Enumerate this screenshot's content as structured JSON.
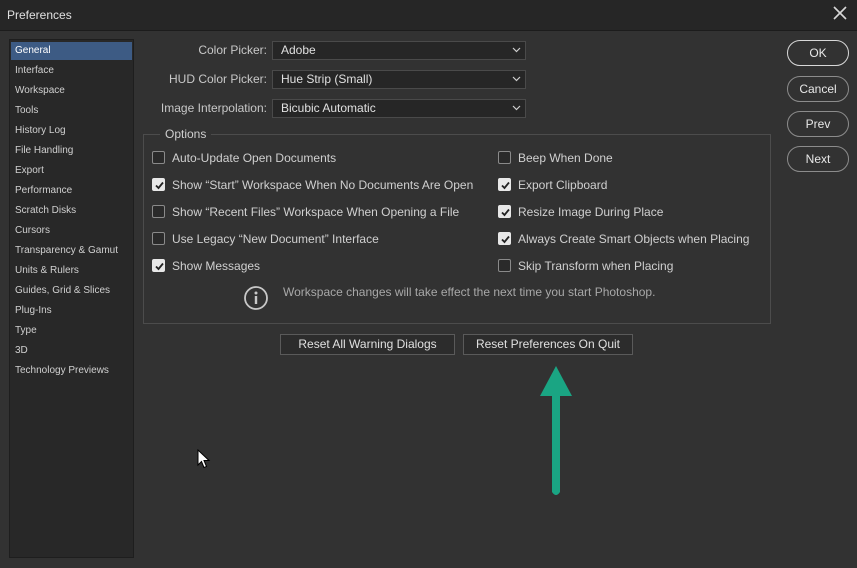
{
  "window": {
    "title": "Preferences"
  },
  "sidebar": {
    "items": [
      {
        "label": "General",
        "active": true
      },
      {
        "label": "Interface"
      },
      {
        "label": "Workspace"
      },
      {
        "label": "Tools"
      },
      {
        "label": "History Log"
      },
      {
        "label": "File Handling"
      },
      {
        "label": "Export"
      },
      {
        "label": "Performance"
      },
      {
        "label": "Scratch Disks"
      },
      {
        "label": "Cursors"
      },
      {
        "label": "Transparency & Gamut"
      },
      {
        "label": "Units & Rulers"
      },
      {
        "label": "Guides, Grid & Slices"
      },
      {
        "label": "Plug-Ins"
      },
      {
        "label": "Type"
      },
      {
        "label": "3D"
      },
      {
        "label": "Technology Previews"
      }
    ]
  },
  "fields": {
    "color_picker": {
      "label": "Color Picker:",
      "value": "Adobe"
    },
    "hud_color_picker": {
      "label": "HUD Color Picker:",
      "value": "Hue Strip (Small)"
    },
    "image_interpolation": {
      "label": "Image Interpolation:",
      "value": "Bicubic Automatic"
    }
  },
  "options": {
    "legend": "Options",
    "left": [
      {
        "label": "Auto-Update Open Documents",
        "checked": false
      },
      {
        "label": "Show “Start” Workspace When No Documents Are Open",
        "checked": true
      },
      {
        "label": "Show “Recent Files” Workspace When Opening a File",
        "checked": false
      },
      {
        "label": "Use Legacy “New Document” Interface",
        "checked": false
      },
      {
        "label": "Show Messages",
        "checked": true
      }
    ],
    "right": [
      {
        "label": "Beep When Done",
        "checked": false
      },
      {
        "label": "Export Clipboard",
        "checked": true
      },
      {
        "label": "Resize Image During Place",
        "checked": true
      },
      {
        "label": "Always Create Smart Objects when Placing",
        "checked": true
      },
      {
        "label": "Skip Transform when Placing",
        "checked": false
      }
    ],
    "info": "Workspace changes will take effect the next time you start Photoshop."
  },
  "buttons": {
    "reset_warnings": "Reset All Warning Dialogs",
    "reset_prefs": "Reset Preferences On Quit",
    "ok": "OK",
    "cancel": "Cancel",
    "prev": "Prev",
    "next": "Next"
  },
  "colors": {
    "background": "#323232",
    "selection": "#3d5b84",
    "annotation_arrow": "#1aa583"
  },
  "icons": [
    "close-icon",
    "chevron-down-icon",
    "checkmark-icon",
    "info-icon",
    "mouse-cursor-icon",
    "annotation-arrow"
  ]
}
